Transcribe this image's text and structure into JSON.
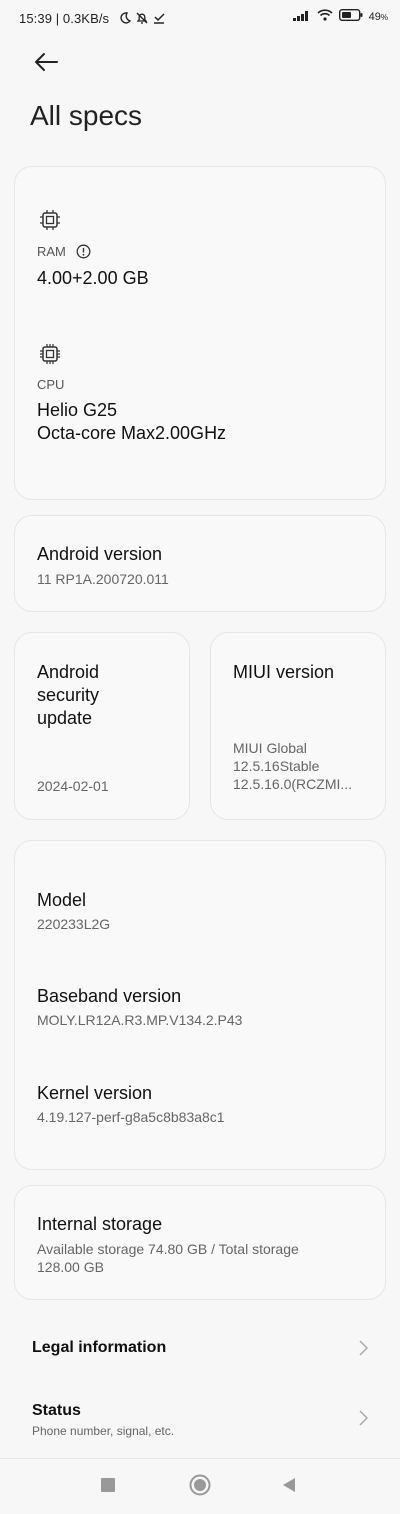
{
  "status_bar": {
    "time_and_speed": "15:39 | 0.3KB/s",
    "battery_percent": "49"
  },
  "header": {
    "title": "All specs"
  },
  "ram": {
    "label": "RAM",
    "value": "4.00+2.00 GB"
  },
  "cpu": {
    "label": "CPU",
    "line1": "Helio G25",
    "line2": "Octa-core Max2.00GHz"
  },
  "android_version": {
    "label": "Android version",
    "value": "11 RP1A.200720.011"
  },
  "security_update": {
    "label_l1": "Android",
    "label_l2": "security",
    "label_l3": "update",
    "value": "2024-02-01"
  },
  "miui_version": {
    "label": "MIUI version",
    "line1": "MIUI Global",
    "line2": "12.5.16Stable",
    "line3": "12.5.16.0(RCZMI..."
  },
  "model": {
    "label": "Model",
    "value": "220233L2G"
  },
  "baseband": {
    "label": "Baseband version",
    "value": "MOLY.LR12A.R3.MP.V134.2.P43"
  },
  "kernel": {
    "label": "Kernel version",
    "value": "4.19.127-perf-g8a5c8b83a8c1"
  },
  "storage": {
    "label": "Internal storage",
    "line1": "Available storage  74.80 GB / Total storage",
    "line2": "128.00 GB"
  },
  "menu": {
    "legal": {
      "title": "Legal information"
    },
    "status": {
      "title": "Status",
      "subtitle": "Phone number, signal, etc."
    }
  }
}
